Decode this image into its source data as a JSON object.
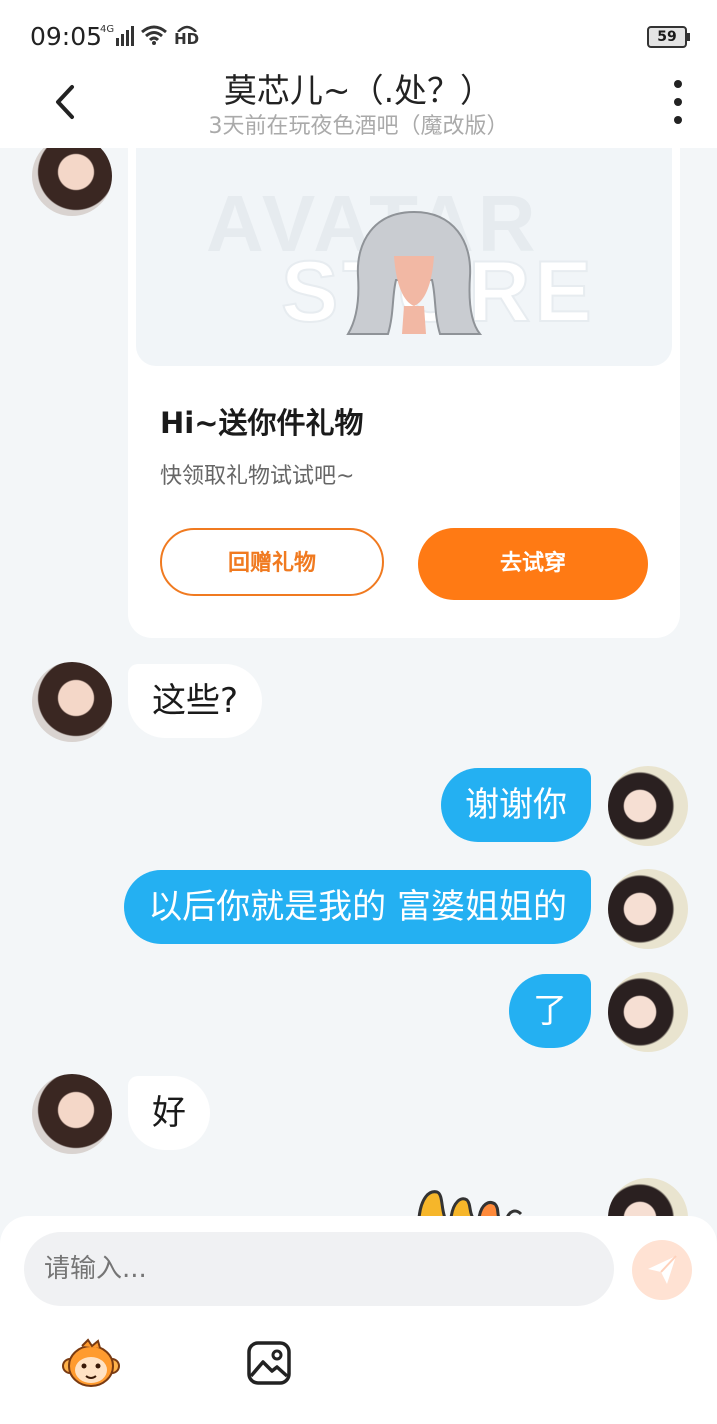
{
  "status": {
    "time": "09:05",
    "network": "4G",
    "hd": "HD",
    "battery": "59"
  },
  "header": {
    "title": "莫芯儿~（.处？）",
    "subtitle": "3天前在玩夜色酒吧（魔改版）",
    "back_icon": "chevron-left-icon",
    "more_icon": "more-vertical-icon"
  },
  "gift_card": {
    "watermark_line1": "AVATAR",
    "watermark_line2": "STORE",
    "title": "Hi~送你件礼物",
    "description": "快领取礼物试试吧~",
    "return_gift_label": "回赠礼物",
    "try_on_label": "去试穿"
  },
  "messages": [
    {
      "sender": "other",
      "text": "这些?"
    },
    {
      "sender": "me",
      "text": "谢谢你"
    },
    {
      "sender": "me",
      "text": "以后你就是我的 富婆姐姐的"
    },
    {
      "sender": "me",
      "text": "了"
    },
    {
      "sender": "other",
      "text": "好"
    }
  ],
  "composer": {
    "placeholder": "请输入...",
    "send_icon": "paper-plane-icon",
    "emoji_icon": "monkey-emoji-icon",
    "image_icon": "image-icon"
  },
  "colors": {
    "accent_orange": "#ff7a14",
    "bubble_blue": "#24b0f2",
    "background": "#f3f6f8"
  }
}
